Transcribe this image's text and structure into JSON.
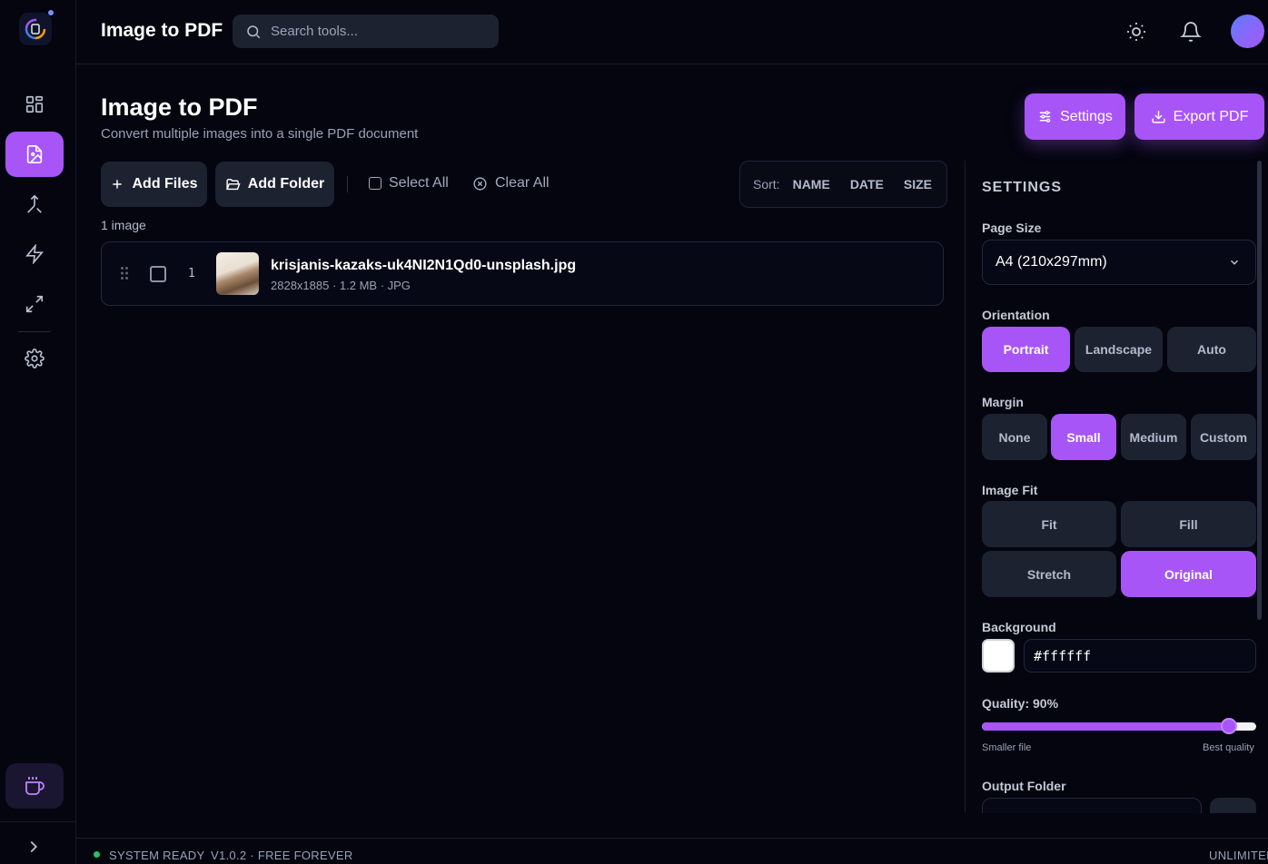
{
  "header": {
    "title": "Image to PDF",
    "search_placeholder": "Search tools..."
  },
  "page": {
    "title": "Image to PDF",
    "subtitle": "Convert multiple images into a single PDF document",
    "settings_button": "Settings",
    "export_button": "Export PDF"
  },
  "toolbar": {
    "add_files": "Add Files",
    "add_folder": "Add Folder",
    "select_all": "Select All",
    "clear_all": "Clear All",
    "sort_label": "Sort:",
    "sort_name": "NAME",
    "sort_date": "DATE",
    "sort_size": "SIZE"
  },
  "files": {
    "count_label": "1 image",
    "items": [
      {
        "index": "1",
        "name": "krisjanis-kazaks-uk4NI2N1Qd0-unsplash.jpg",
        "meta": "2828x1885 · 1.2 MB · JPG"
      }
    ]
  },
  "settings": {
    "heading": "SETTINGS",
    "page_size_label": "Page Size",
    "page_size_value": "A4 (210x297mm)",
    "orientation_label": "Orientation",
    "orientation_options": [
      "Portrait",
      "Landscape",
      "Auto"
    ],
    "orientation_selected": "Portrait",
    "margin_label": "Margin",
    "margin_options": [
      "None",
      "Small",
      "Medium",
      "Custom"
    ],
    "margin_selected": "Small",
    "image_fit_label": "Image Fit",
    "image_fit_options": [
      "Fit",
      "Fill",
      "Stretch",
      "Original"
    ],
    "image_fit_selected": "Original",
    "background_label": "Background",
    "background_value": "#ffffff",
    "quality_label": "Quality: 90%",
    "quality_value": 90,
    "quality_min_label": "Smaller file",
    "quality_max_label": "Best quality",
    "output_folder_label": "Output Folder"
  },
  "status": {
    "ready": "SYSTEM READY",
    "version": "V1.0.2 · FREE FOREVER",
    "right": "UNLIMITED"
  },
  "colors": {
    "accent": "#a855f7",
    "background": "#04050f",
    "surface": "#1d2231",
    "status_ok": "#22c55e"
  },
  "icons": {
    "rail": [
      "dashboard-icon",
      "image-pdf-icon",
      "merge-icon",
      "bolt-icon",
      "resize-icon",
      "gear-icon"
    ],
    "header": [
      "search-icon",
      "sun-icon",
      "bell-icon"
    ]
  }
}
